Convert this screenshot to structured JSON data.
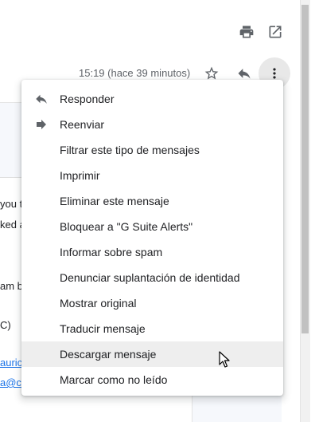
{
  "header": {
    "print_icon": "print-icon",
    "popout_icon": "open-in-new-window-icon"
  },
  "message": {
    "timestamp": "15:19 (hace 39 minutos)",
    "star_icon": "star-outline-icon",
    "reply_icon": "reply-icon",
    "more_icon": "more-vert-icon"
  },
  "background_peek": [
    "you t",
    "ked a",
    "am b",
    "C)",
    "auric",
    "a@c"
  ],
  "menu": {
    "items": [
      {
        "label": "Responder",
        "icon": "reply-icon"
      },
      {
        "label": "Reenviar",
        "icon": "forward-icon"
      },
      {
        "label": "Filtrar este tipo de mensajes"
      },
      {
        "label": "Imprimir"
      },
      {
        "label": "Eliminar este mensaje"
      },
      {
        "label": "Bloquear a \"G Suite Alerts\""
      },
      {
        "label": "Informar sobre spam"
      },
      {
        "label": "Denunciar suplantación de identidad"
      },
      {
        "label": "Mostrar original"
      },
      {
        "label": "Traducir mensaje"
      },
      {
        "label": "Descargar mensaje",
        "hovered": true
      },
      {
        "label": "Marcar como no leído"
      }
    ]
  },
  "colors": {
    "icon_gray": "#5f6368",
    "hover_bg": "#eeeeee",
    "link_blue": "#1a73e8"
  }
}
